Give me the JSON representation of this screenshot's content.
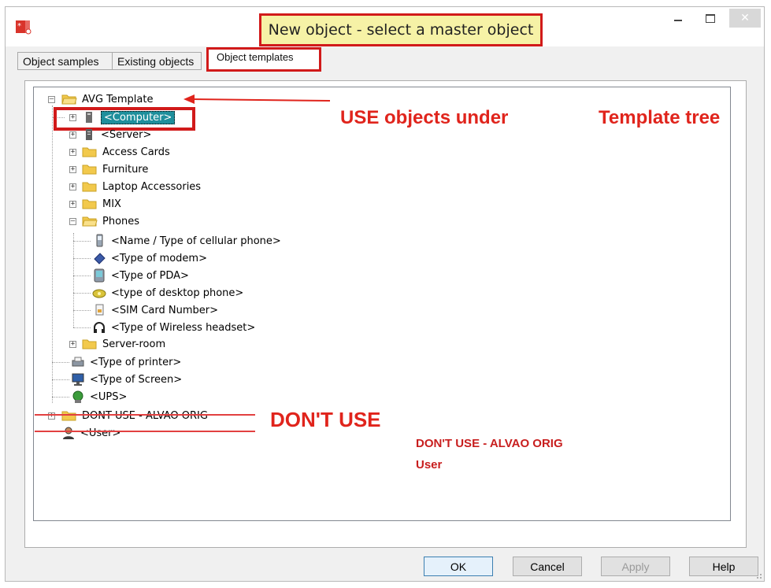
{
  "window": {
    "title": "New object - select a master object",
    "controls": {
      "minimize": "–",
      "maximize": "□",
      "close": "✕"
    }
  },
  "tabs": [
    {
      "label": "Object samples",
      "active": false
    },
    {
      "label": "Existing objects",
      "active": false
    },
    {
      "label": "Object templates",
      "active": true
    }
  ],
  "tree": {
    "root": "AVG Template",
    "items": [
      {
        "label": "<Computer>",
        "icon": "computer-icon",
        "selected": true
      },
      {
        "label": "<Server>",
        "icon": "server-icon"
      },
      {
        "label": "Access Cards",
        "icon": "folder-icon"
      },
      {
        "label": "Furniture",
        "icon": "folder-icon"
      },
      {
        "label": "Laptop Accessories",
        "icon": "folder-icon"
      },
      {
        "label": "MIX",
        "icon": "folder-icon"
      },
      {
        "label": "Phones",
        "icon": "folder-icon",
        "expanded": true
      }
    ],
    "phones": [
      {
        "label": "<Name / Type of cellular phone>",
        "icon": "cellphone-icon"
      },
      {
        "label": "<Type of modem>",
        "icon": "modem-icon"
      },
      {
        "label": "<Type of PDA>",
        "icon": "pda-icon"
      },
      {
        "label": "<type of desktop phone>",
        "icon": "desk-phone-icon"
      },
      {
        "label": "<SIM Card Number>",
        "icon": "sim-card-icon"
      },
      {
        "label": "<Type of Wireless headset>",
        "icon": "headset-icon"
      }
    ],
    "after": [
      {
        "label": "Server-room",
        "icon": "folder-icon"
      },
      {
        "label": "<Type of printer>",
        "icon": "printer-icon"
      },
      {
        "label": "<Type of Screen>",
        "icon": "monitor-icon"
      },
      {
        "label": "<UPS>",
        "icon": "ups-icon"
      }
    ],
    "second_root": "DONT USE - ALVAO ORIG",
    "user_node": "<User>"
  },
  "annotations": {
    "use_objects": "USE objects under",
    "template_tree": "Template tree",
    "dont_use": "DON'T USE",
    "dont_use_orig": "DON'T USE - ALVAO ORIG",
    "user": "User"
  },
  "buttons": {
    "ok": "OK",
    "cancel": "Cancel",
    "apply": "Apply",
    "help": "Help"
  },
  "colors": {
    "annotation_red": "#d11a1a",
    "title_highlight": "#f6f2a6",
    "selection": "#1f8f9c"
  }
}
